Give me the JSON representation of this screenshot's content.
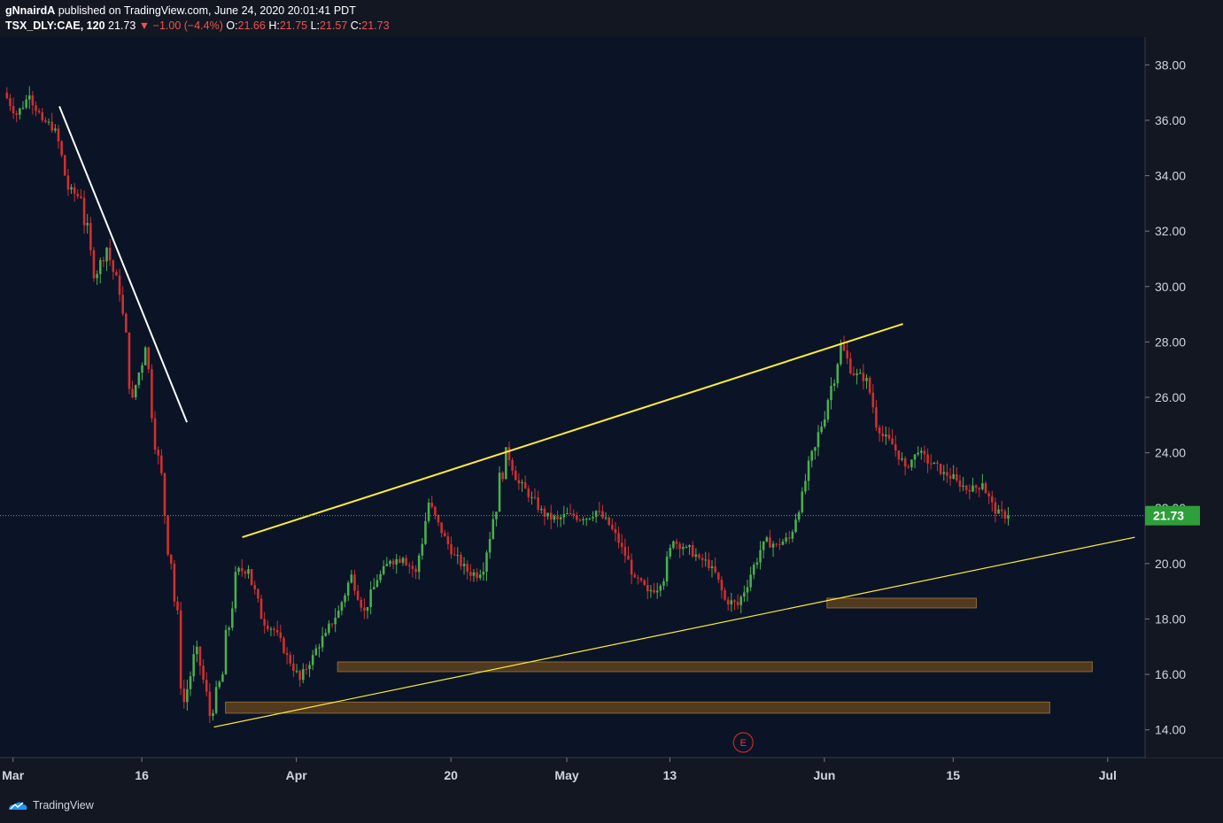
{
  "header": {
    "author": "gNnairdA",
    "published_text": "published on TradingView.com, June 24, 2020 20:01:41 PDT",
    "symbol": "TSX_DLY:CAE, 120",
    "last": "21.73",
    "change": "▼ −1.00 (−4.4%)",
    "o_label": "O:",
    "o_value": "21.66",
    "h_label": "H:",
    "h_value": "21.75",
    "l_label": "L:",
    "l_value": "21.57",
    "c_label": "C:",
    "c_value": "21.73"
  },
  "footer": {
    "brand": "TradingView"
  },
  "colors": {
    "background": "#0b1426",
    "up": "#4caf50",
    "down": "#d32f2f",
    "price_label": "#2e9f3a",
    "trendline_yellow": "#ffeb3b",
    "trendline_white": "#ffffff",
    "zone_fill": "#5a3e1f"
  },
  "chart_data": {
    "type": "candlestick",
    "symbol": "TSX_DLY:CAE",
    "interval": "120",
    "ylim": [
      13.0,
      39.0
    ],
    "y_ticks": [
      "14.00",
      "16.00",
      "18.00",
      "20.00",
      "22.00",
      "24.00",
      "26.00",
      "28.00",
      "30.00",
      "32.00",
      "34.00",
      "36.00",
      "38.00"
    ],
    "x_ticks": [
      {
        "label": "Mar",
        "t": 0.6
      },
      {
        "label": "16",
        "t": 10.6
      },
      {
        "label": "Apr",
        "t": 22.6
      },
      {
        "label": "20",
        "t": 34.6
      },
      {
        "label": "May",
        "t": 43.6
      },
      {
        "label": "13",
        "t": 51.6
      },
      {
        "label": "Jun",
        "t": 63.6
      },
      {
        "label": "15",
        "t": 73.6
      },
      {
        "label": "Jul",
        "t": 85.6
      }
    ],
    "last_price": "21.73",
    "last_price_value": 21.73,
    "earnings_marker": {
      "label": "E",
      "t": 57.3
    },
    "trading_days": 79,
    "close_path": [
      [
        0,
        37.0
      ],
      [
        1,
        36.2
      ],
      [
        2,
        36.9
      ],
      [
        3,
        36.0
      ],
      [
        4,
        35.7
      ],
      [
        5,
        33.5
      ],
      [
        6,
        33.2
      ],
      [
        7,
        30.3
      ],
      [
        8,
        31.4
      ],
      [
        9,
        29.7
      ],
      [
        10,
        26.0
      ],
      [
        11,
        27.8
      ],
      [
        12,
        23.9
      ],
      [
        13,
        20.0
      ],
      [
        14,
        15.0
      ],
      [
        15,
        17.0
      ],
      [
        16,
        14.5
      ],
      [
        17,
        16.0
      ],
      [
        18,
        19.7
      ],
      [
        19,
        19.8
      ],
      [
        20,
        18.0
      ],
      [
        21,
        17.6
      ],
      [
        22,
        16.7
      ],
      [
        23,
        15.8
      ],
      [
        24,
        16.7
      ],
      [
        25,
        17.5
      ],
      [
        26,
        18.3
      ],
      [
        27,
        19.6
      ],
      [
        28,
        18.3
      ],
      [
        29,
        19.4
      ],
      [
        30,
        20.1
      ],
      [
        31,
        20.2
      ],
      [
        32,
        19.7
      ],
      [
        33,
        22.2
      ],
      [
        34,
        21.1
      ],
      [
        35,
        20.3
      ],
      [
        36,
        19.7
      ],
      [
        37,
        19.6
      ],
      [
        38,
        21.6
      ],
      [
        39,
        24.2
      ],
      [
        40,
        22.9
      ],
      [
        41,
        22.4
      ],
      [
        42,
        21.7
      ],
      [
        43,
        21.6
      ],
      [
        44,
        21.8
      ],
      [
        45,
        21.6
      ],
      [
        46,
        21.9
      ],
      [
        47,
        21.4
      ],
      [
        48,
        20.6
      ],
      [
        49,
        19.5
      ],
      [
        50,
        19.0
      ],
      [
        51,
        19.2
      ],
      [
        52,
        20.8
      ],
      [
        53,
        20.6
      ],
      [
        54,
        20.2
      ],
      [
        55,
        19.9
      ],
      [
        56,
        18.7
      ],
      [
        57,
        18.5
      ],
      [
        58,
        19.6
      ],
      [
        59,
        20.8
      ],
      [
        60,
        20.7
      ],
      [
        61,
        20.9
      ],
      [
        62,
        22.6
      ],
      [
        63,
        24.2
      ],
      [
        64,
        25.9
      ],
      [
        65,
        27.9
      ],
      [
        66,
        26.8
      ],
      [
        67,
        26.7
      ],
      [
        68,
        24.7
      ],
      [
        69,
        24.3
      ],
      [
        70,
        23.5
      ],
      [
        71,
        24.0
      ],
      [
        72,
        23.6
      ],
      [
        73,
        23.3
      ],
      [
        74,
        23.0
      ],
      [
        75,
        22.6
      ],
      [
        76,
        22.9
      ],
      [
        77,
        21.8
      ],
      [
        78,
        21.73
      ]
    ],
    "trendlines": [
      {
        "name": "upper-resistance",
        "color": "#ffeb3b",
        "from": [
          18.4,
          20.95
        ],
        "to": [
          69.7,
          28.65
        ]
      },
      {
        "name": "lower-support",
        "color": "#ffeb3b",
        "from": [
          16.2,
          14.1
        ],
        "to": [
          87.7,
          20.95
        ]
      },
      {
        "name": "downtrend",
        "color": "#ffffff",
        "from": [
          4.2,
          36.5
        ],
        "to": [
          14.1,
          25.1
        ]
      }
    ],
    "zones": [
      {
        "name": "zone-upper",
        "t0": 63.8,
        "t1": 75.4,
        "y0": 18.4,
        "y1": 18.75
      },
      {
        "name": "zone-middle",
        "t0": 25.8,
        "t1": 84.4,
        "y0": 16.1,
        "y1": 16.45
      },
      {
        "name": "zone-lower",
        "t0": 17.1,
        "t1": 81.1,
        "y0": 14.6,
        "y1": 15.0
      }
    ]
  }
}
